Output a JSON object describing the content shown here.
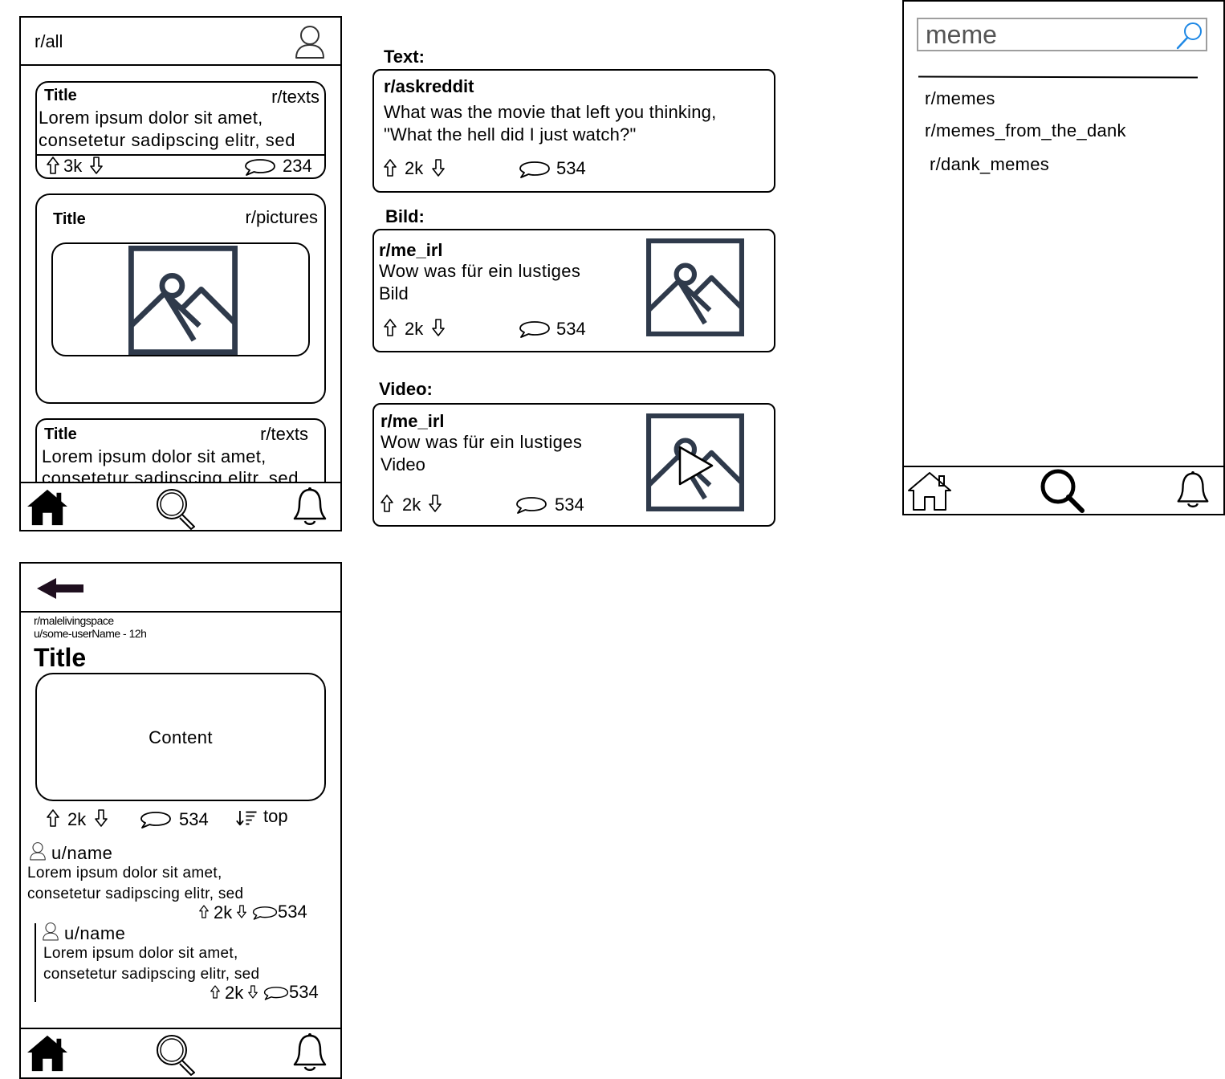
{
  "feed": {
    "header_title": "r/all",
    "posts": [
      {
        "title": "Title",
        "subreddit": "r/texts",
        "line1": "Lorem ipsum dolor sit amet,",
        "line2": "consetetur sadipscing elitr, sed",
        "votes": "3k",
        "comments": "234"
      },
      {
        "title": "Title",
        "subreddit": "r/pictures"
      },
      {
        "title": "Title",
        "subreddit": "r/texts",
        "line1": "Lorem ipsum dolor sit amet,",
        "line2": "consetetur sadipscing elitr, sed"
      }
    ]
  },
  "examples": {
    "text_heading": "Text:",
    "text_post": {
      "subreddit": "r/askreddit",
      "line1": "What was the movie that left you thinking,",
      "line2": "\"What the hell did I just watch?\"",
      "votes": "2k",
      "comments": "534"
    },
    "image_heading": "Bild:",
    "image_post": {
      "subreddit": "r/me_irl",
      "line1": "Wow was für ein lustiges",
      "line2": "Bild",
      "votes": "2k",
      "comments": "534"
    },
    "video_heading": "Video:",
    "video_post": {
      "subreddit": "r/me_irl",
      "line1": "Wow was für ein lustiges",
      "line2": "Video",
      "votes": "2k",
      "comments": "534"
    }
  },
  "search": {
    "query": "meme",
    "results": [
      "r/memes",
      "r/memes_from_the_dank",
      "r/dank_memes"
    ]
  },
  "detail": {
    "subreddit": "r/malelivingspace",
    "meta": "u/some-userName - 12h",
    "title": "Title",
    "content_label": "Content",
    "votes": "2k",
    "comments": "534",
    "sort_label": "top",
    "comments_list": [
      {
        "user": "u/name",
        "line1": "Lorem ipsum dolor sit amet,",
        "line2": "consetetur sadipscing elitr, sed",
        "votes": "2k",
        "comments": "534"
      },
      {
        "user": "u/name",
        "line1": "Lorem ipsum dolor sit amet,",
        "line2": "consetetur sadipscing elitr, sed",
        "votes": "2k",
        "comments": "534"
      }
    ]
  },
  "icons": {
    "image_placeholder_color": "#2f3a4b",
    "search_accent": "#1e88e5",
    "back_arrow_color": "#1f0f1f"
  }
}
